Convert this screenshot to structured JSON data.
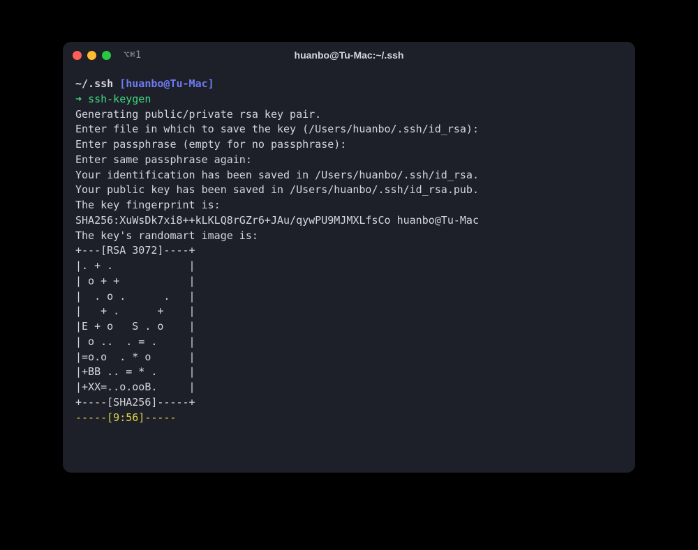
{
  "titlebar": {
    "tab_label": "⌥⌘1",
    "title": "huanbo@Tu-Mac:~/.ssh"
  },
  "prompt": {
    "path": "~/.ssh",
    "user_host": "[huanbo@Tu-Mac]",
    "arrow": "➜",
    "command": "ssh-keygen"
  },
  "output": {
    "line1": "Generating public/private rsa key pair.",
    "line2": "Enter file in which to save the key (/Users/huanbo/.ssh/id_rsa):",
    "line3": "Enter passphrase (empty for no passphrase):",
    "line4": "Enter same passphrase again:",
    "line5": "Your identification has been saved in /Users/huanbo/.ssh/id_rsa.",
    "line6": "Your public key has been saved in /Users/huanbo/.ssh/id_rsa.pub.",
    "line7": "The key fingerprint is:",
    "line8": "SHA256:XuWsDk7xi8++kLKLQ8rGZr6+JAu/qywPU9MJMXLfsCo huanbo@Tu-Mac",
    "line9": "The key's randomart image is:",
    "art0": "+---[RSA 3072]----+",
    "art1": "|. + .            |",
    "art2": "| o + +           |",
    "art3": "|  . o .      .   |",
    "art4": "|   + .      +    |",
    "art5": "|E + o   S . o    |",
    "art6": "| o ..  . = .     |",
    "art7": "|=o.o  . * o      |",
    "art8": "|+BB .. = * .     |",
    "art9": "|+XX=..o.ooB.     |",
    "art10": "+----[SHA256]-----+"
  },
  "time_marker": "-----[9:56]-----"
}
